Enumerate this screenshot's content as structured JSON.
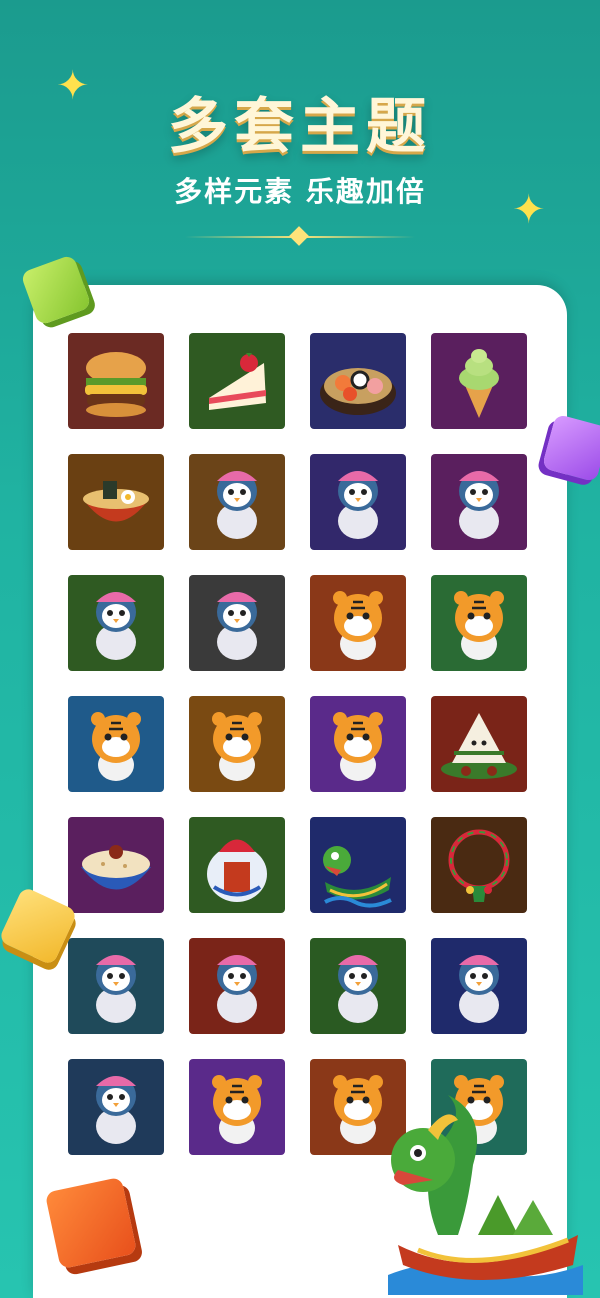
{
  "header": {
    "title": "多套主题",
    "subtitle": "多样元素 乐趣加倍"
  },
  "colors": {
    "background": "#20b3a2",
    "title_text": "#fff6d8",
    "accent_yellow": "#ffe14d"
  },
  "themes": [
    {
      "name": "burger-theme",
      "bg": "#6b2a23",
      "icon": "burger-icon"
    },
    {
      "name": "cake-theme",
      "bg": "#2f5a22",
      "icon": "cake-icon"
    },
    {
      "name": "sushi-theme",
      "bg": "#2a2d6b",
      "icon": "sushi-icon"
    },
    {
      "name": "ice-cream-theme",
      "bg": "#5a1f5e",
      "icon": "ice-cream-icon"
    },
    {
      "name": "ramen-theme",
      "bg": "#6a4012",
      "icon": "ramen-icon"
    },
    {
      "name": "penguin-beanie-theme",
      "bg": "#6b4418",
      "icon": "penguin-icon"
    },
    {
      "name": "penguin-beret-theme",
      "bg": "#32286b",
      "icon": "penguin-icon"
    },
    {
      "name": "penguin-frog-hat-theme",
      "bg": "#5a1f5e",
      "icon": "penguin-icon"
    },
    {
      "name": "penguin-helmet-theme",
      "bg": "#2f5a22",
      "icon": "penguin-icon"
    },
    {
      "name": "penguin-yellow-theme",
      "bg": "#3a3a3a",
      "icon": "penguin-icon"
    },
    {
      "name": "tiger-sunglasses-theme",
      "bg": "#8a3818",
      "icon": "tiger-icon"
    },
    {
      "name": "tiger-skate-theme",
      "bg": "#2a6b34",
      "icon": "tiger-icon"
    },
    {
      "name": "tiger-reading-theme",
      "bg": "#1f5a8a",
      "icon": "tiger-icon"
    },
    {
      "name": "tiger-magnifier-theme",
      "bg": "#7a4a12",
      "icon": "tiger-icon"
    },
    {
      "name": "tiger-headphones-theme",
      "bg": "#5a2a8a",
      "icon": "tiger-icon"
    },
    {
      "name": "zongzi-theme",
      "bg": "#7a2418",
      "icon": "zongzi-icon"
    },
    {
      "name": "rice-bowl-theme",
      "bg": "#5a1f5e",
      "icon": "rice-bowl-icon"
    },
    {
      "name": "wine-jar-theme",
      "bg": "#2f5a22",
      "icon": "wine-jar-icon"
    },
    {
      "name": "dragon-boat-theme",
      "bg": "#1f2a6b",
      "icon": "dragon-icon"
    },
    {
      "name": "bracelet-theme",
      "bg": "#4a2a12",
      "icon": "bracelet-icon"
    },
    {
      "name": "penguin-skateboard-theme",
      "bg": "#1f4a5a",
      "icon": "penguin-icon"
    },
    {
      "name": "penguin-bear-theme",
      "bg": "#7a2418",
      "icon": "penguin-icon"
    },
    {
      "name": "penguin-traveler-theme",
      "bg": "#2a5a22",
      "icon": "penguin-icon"
    },
    {
      "name": "penguin-winter-theme",
      "bg": "#1f2a6b",
      "icon": "penguin-icon"
    },
    {
      "name": "penguin-astronaut-theme",
      "bg": "#1f3a5a",
      "icon": "penguin-icon"
    },
    {
      "name": "tiger-gamer-theme",
      "bg": "#5a2a8a",
      "icon": "tiger-icon"
    },
    {
      "name": "tiger-noodles-theme",
      "bg": "#8a3818",
      "icon": "tiger-icon"
    },
    {
      "name": "tiger-teal-theme",
      "bg": "#1f6b5a",
      "icon": "tiger-icon"
    }
  ]
}
